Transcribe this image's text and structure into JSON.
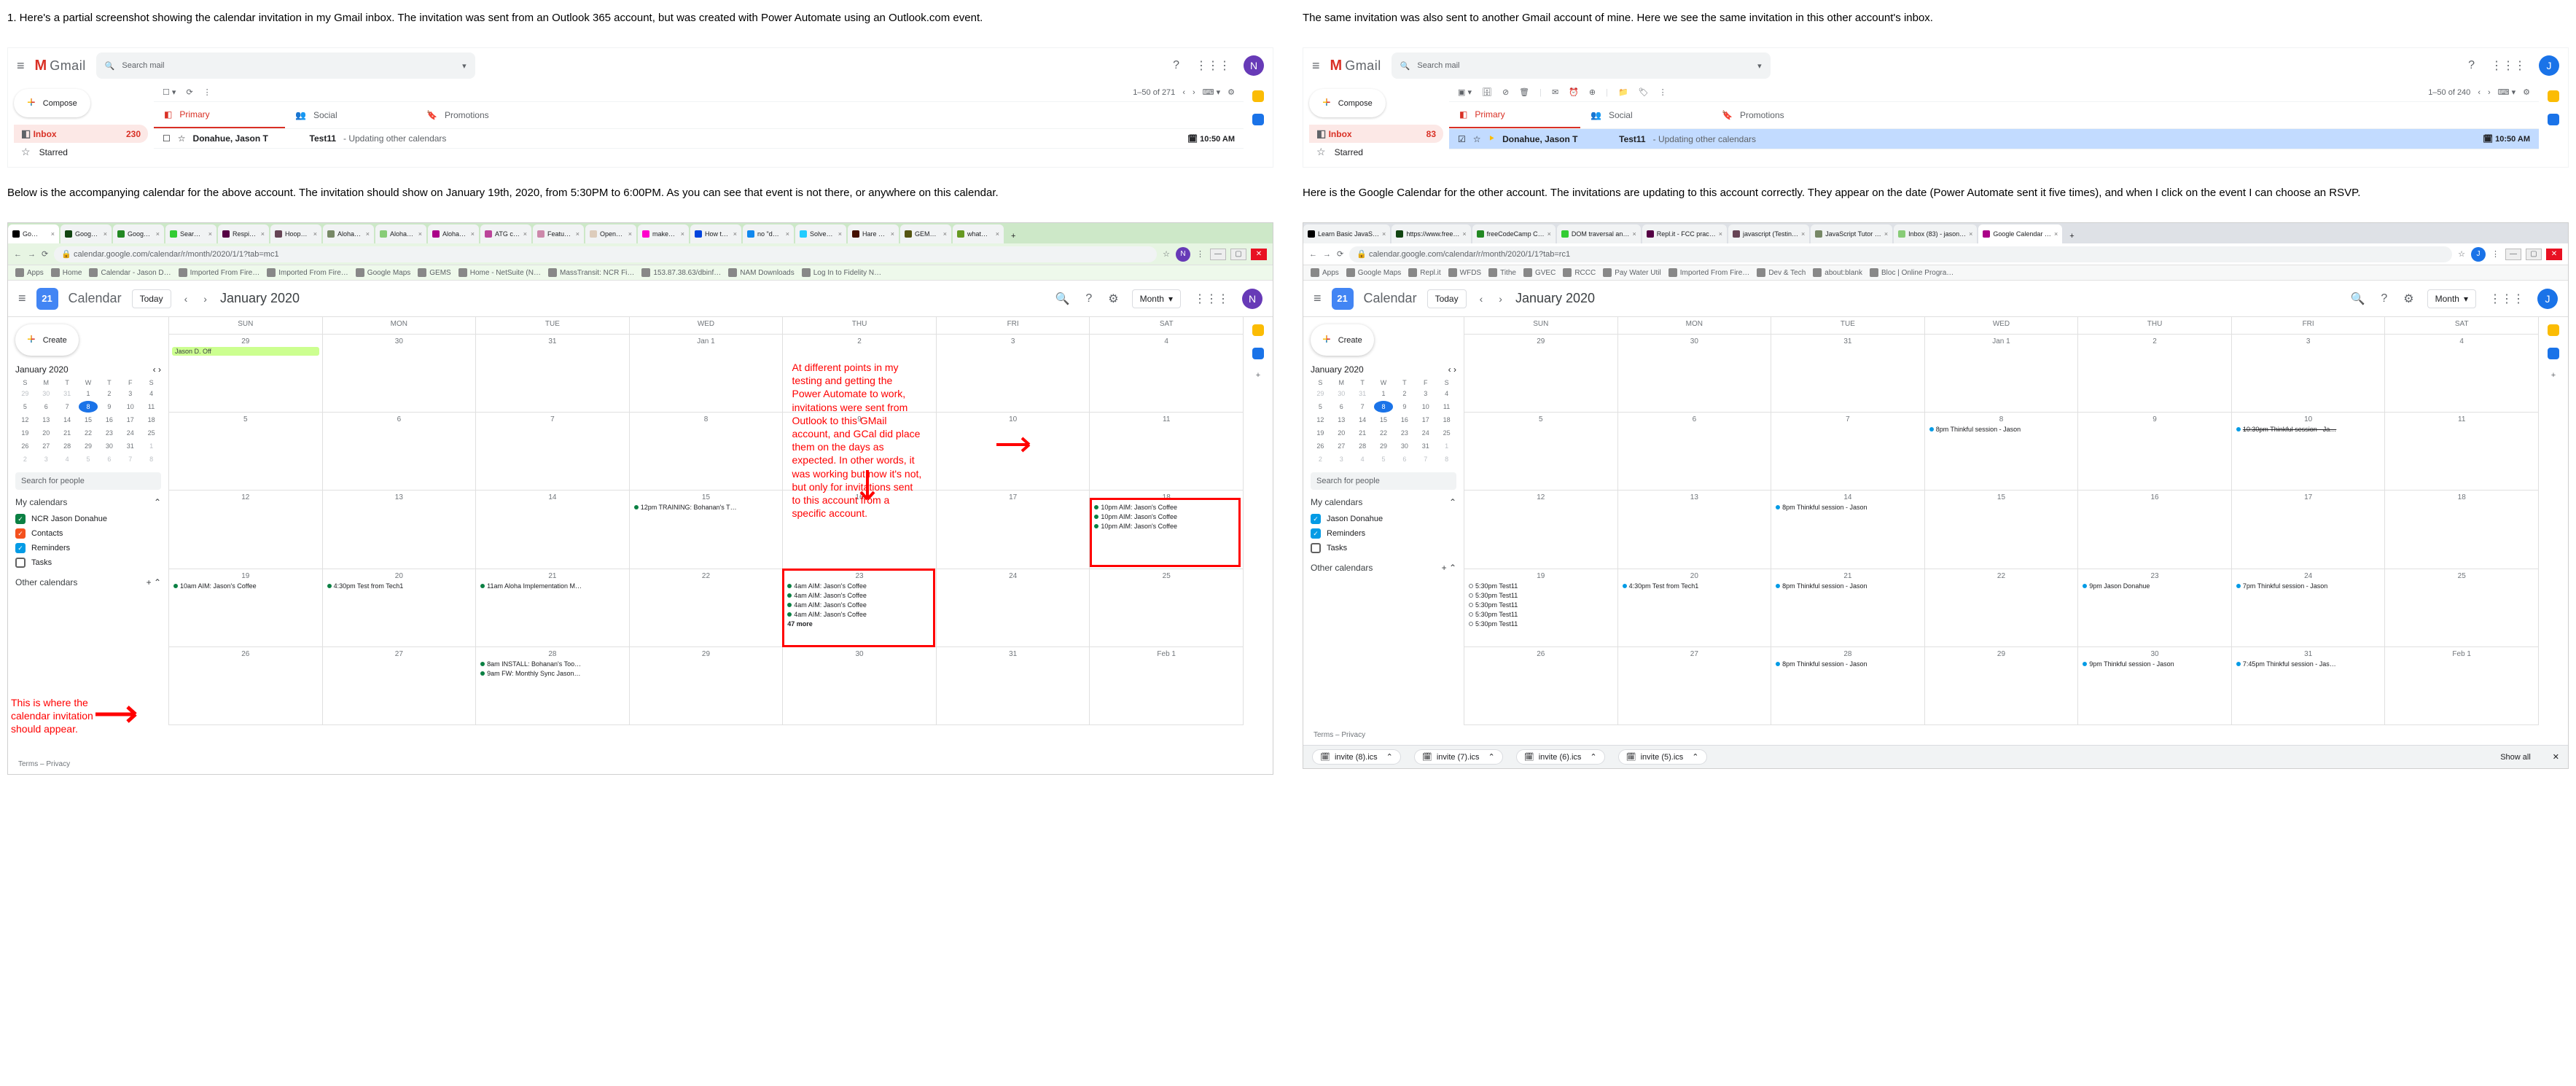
{
  "descriptions": {
    "left_intro": "1. Here's a partial screenshot showing the calendar invitation in my Gmail inbox. The invitation was sent from an Outlook 365 account, but was created with Power Automate using an Outlook.com event.",
    "right_intro": "The same invitation was also sent to another Gmail account of mine.  Here we see the same invitation in this other account's inbox.",
    "left_mid": "Below is the accompanying calendar for the above account.  The invitation should show on January 19th, 2020, from 5:30PM to 6:00PM. As you can see that event is not there, or anywhere on this calendar.",
    "right_mid": "Here is the Google Calendar for the other account.  The invitations are updating to this account correctly.  They appear on the date (Power Automate sent it five times), and when I click on the event I can choose an RSVP."
  },
  "gmail_common": {
    "logo_letter": "M",
    "logo_word": "Gmail",
    "search_placeholder": "Search mail",
    "compose": "Compose",
    "inbox": "Inbox",
    "starred": "Starred",
    "tabs": {
      "primary": "Primary",
      "social": "Social",
      "promotions": "Promotions"
    }
  },
  "gmail_left": {
    "inbox_count": "230",
    "page_range": "1–50 of 271",
    "avatar_letter": "N",
    "mail": {
      "sender": "Donahue, Jason T",
      "subject": "Test11",
      "snippet": " - Updating other calendars",
      "time": "10:50 AM"
    }
  },
  "gmail_right": {
    "inbox_count": "83",
    "page_range": "1–50 of 240",
    "avatar_letter": "J",
    "mail": {
      "sender": "Donahue, Jason T",
      "subject": "Test11",
      "snippet": " - Updating other calendars",
      "time": "10:50 AM"
    }
  },
  "browser_left": {
    "url": "calendar.google.com/calendar/r/month/2020/1/1?tab=mc1",
    "tabs": [
      "Go…",
      "Goog…",
      "Goog…",
      "Sear…",
      "Respi…",
      "Hoop…",
      "Aloha…",
      "Aloha…",
      "Aloha…",
      "ATG c…",
      "Featu…",
      "Open…",
      "make…",
      "How t…",
      "no \"d…",
      "Solve…",
      "Hare …",
      "GEM…",
      "what…"
    ],
    "bookmarks": [
      "Apps",
      "Home",
      "Calendar - Jason D…",
      "Imported From Fire…",
      "Imported From Fire…",
      "Google Maps",
      "GEMS",
      "Home - NetSuite (N…",
      "MassTransit: NCR Fi…",
      "153.87.38.63/dbinf…",
      "NAM Downloads",
      "Log In to Fidelity N…"
    ]
  },
  "browser_right": {
    "url": "calendar.google.com/calendar/r/month/2020/1/1?tab=rc1",
    "tabs": [
      "Learn Basic JavaS…",
      "https://www.free…",
      "freeCodeCamp C…",
      "DOM traversal an…",
      "Repl.it - FCC prac…",
      "javascript (Testin…",
      "JavaScript Tutor …",
      "Inbox (83) - jason…",
      "Google Calendar …"
    ],
    "bookmarks": [
      "Apps",
      "Google Maps",
      "Repl.it",
      "WFDS",
      "Tithe",
      "GVEC",
      "RCCC",
      "Pay Water Util",
      "Imported From Fire…",
      "Dev & Tech",
      "about:blank",
      "Bloc | Online Progra…"
    ]
  },
  "cal_common": {
    "app_name": "Calendar",
    "today": "Today",
    "month_label": "January 2020",
    "view": "Month",
    "create": "Create",
    "search_people": "Search for people",
    "my_calendars": "My calendars",
    "other_calendars": "Other calendars",
    "footer": "Terms – Privacy",
    "dow": [
      "SUN",
      "MON",
      "TUE",
      "WED",
      "THU",
      "FRI",
      "SAT"
    ],
    "mini_dow": [
      "S",
      "M",
      "T",
      "W",
      "T",
      "F",
      "S"
    ],
    "mini_month": "January 2020",
    "mini_days": [
      {
        "n": "29",
        "dim": true
      },
      {
        "n": "30",
        "dim": true
      },
      {
        "n": "31",
        "dim": true
      },
      {
        "n": "1"
      },
      {
        "n": "2"
      },
      {
        "n": "3"
      },
      {
        "n": "4"
      },
      {
        "n": "5"
      },
      {
        "n": "6"
      },
      {
        "n": "7"
      },
      {
        "n": "8",
        "today": true
      },
      {
        "n": "9"
      },
      {
        "n": "10"
      },
      {
        "n": "11"
      },
      {
        "n": "12"
      },
      {
        "n": "13"
      },
      {
        "n": "14"
      },
      {
        "n": "15"
      },
      {
        "n": "16"
      },
      {
        "n": "17"
      },
      {
        "n": "18"
      },
      {
        "n": "19"
      },
      {
        "n": "20"
      },
      {
        "n": "21"
      },
      {
        "n": "22"
      },
      {
        "n": "23"
      },
      {
        "n": "24"
      },
      {
        "n": "25"
      },
      {
        "n": "26"
      },
      {
        "n": "27"
      },
      {
        "n": "28"
      },
      {
        "n": "29"
      },
      {
        "n": "30"
      },
      {
        "n": "31"
      },
      {
        "n": "1",
        "dim": true
      },
      {
        "n": "2",
        "dim": true
      },
      {
        "n": "3",
        "dim": true
      },
      {
        "n": "4",
        "dim": true
      },
      {
        "n": "5",
        "dim": true
      },
      {
        "n": "6",
        "dim": true
      },
      {
        "n": "7",
        "dim": true
      },
      {
        "n": "8",
        "dim": true
      }
    ]
  },
  "cal_left": {
    "logo_day": "21",
    "avatar_letter": "N",
    "my_cals": [
      {
        "label": "NCR Jason Donahue",
        "color": "#0b8043",
        "on": true
      },
      {
        "label": "Contacts",
        "color": "#f4511e",
        "on": true
      },
      {
        "label": "Reminders",
        "color": "#039be5",
        "on": true
      },
      {
        "label": "Tasks",
        "color": "#616161",
        "on": false
      }
    ],
    "weeks": [
      [
        {
          "n": "29",
          "ev": [
            {
              "t": "Jason D. Off",
              "bar": "#ccff90"
            }
          ]
        },
        {
          "n": "30"
        },
        {
          "n": "31"
        },
        {
          "n": "Jan 1"
        },
        {
          "n": "2"
        },
        {
          "n": "3"
        },
        {
          "n": "4"
        }
      ],
      [
        {
          "n": "5"
        },
        {
          "n": "6"
        },
        {
          "n": "7"
        },
        {
          "n": "8"
        },
        {
          "n": "9"
        },
        {
          "n": "10"
        },
        {
          "n": "11"
        }
      ],
      [
        {
          "n": "12"
        },
        {
          "n": "13"
        },
        {
          "n": "14"
        },
        {
          "n": "15",
          "ev": [
            {
              "t": "12pm TRAINING: Bohanan's T…",
              "c": "#0b8043"
            }
          ]
        },
        {
          "n": "16"
        },
        {
          "n": "17"
        },
        {
          "n": "18",
          "ev": [
            {
              "t": "10pm AIM: Jason's Coffee",
              "c": "#0b8043"
            },
            {
              "t": "10pm AIM: Jason's Coffee",
              "c": "#0b8043"
            },
            {
              "t": "10pm AIM: Jason's Coffee",
              "c": "#0b8043"
            }
          ]
        }
      ],
      [
        {
          "n": "19",
          "ev": [
            {
              "t": "10am AIM: Jason's Coffee",
              "c": "#0b8043"
            }
          ]
        },
        {
          "n": "20",
          "ev": [
            {
              "t": "4:30pm Test from Tech1",
              "c": "#0b8043"
            }
          ]
        },
        {
          "n": "21",
          "ev": [
            {
              "t": "11am Aloha Implementation M…",
              "c": "#0b8043"
            }
          ]
        },
        {
          "n": "22"
        },
        {
          "n": "23",
          "ev": [
            {
              "t": "4am AIM: Jason's Coffee",
              "c": "#0b8043"
            },
            {
              "t": "4am AIM: Jason's Coffee",
              "c": "#0b8043"
            },
            {
              "t": "4am AIM: Jason's Coffee",
              "c": "#0b8043"
            },
            {
              "t": "4am AIM: Jason's Coffee",
              "c": "#0b8043"
            }
          ],
          "more": "47 more"
        },
        {
          "n": "24"
        },
        {
          "n": "25"
        }
      ],
      [
        {
          "n": "26"
        },
        {
          "n": "27"
        },
        {
          "n": "28",
          "ev": [
            {
              "t": "8am INSTALL: Bohanan's Too…",
              "c": "#0b8043"
            },
            {
              "t": "9am FW: Monthly Sync Jason…",
              "c": "#0b8043"
            }
          ]
        },
        {
          "n": "29"
        },
        {
          "n": "30"
        },
        {
          "n": "31"
        },
        {
          "n": "Feb 1"
        }
      ]
    ]
  },
  "cal_right": {
    "logo_day": "21",
    "avatar_letter": "J",
    "my_cals": [
      {
        "label": "Jason Donahue",
        "color": "#039be5",
        "on": true
      },
      {
        "label": "Reminders",
        "color": "#039be5",
        "on": true
      },
      {
        "label": "Tasks",
        "color": "#616161",
        "on": false
      }
    ],
    "weeks": [
      [
        {
          "n": "29"
        },
        {
          "n": "30"
        },
        {
          "n": "31"
        },
        {
          "n": "Jan 1"
        },
        {
          "n": "2"
        },
        {
          "n": "3"
        },
        {
          "n": "4"
        }
      ],
      [
        {
          "n": "5"
        },
        {
          "n": "6"
        },
        {
          "n": "7"
        },
        {
          "n": "8",
          "ev": [
            {
              "t": "8pm Thinkful session - Jason",
              "c": "#039be5"
            }
          ]
        },
        {
          "n": "9"
        },
        {
          "n": "10",
          "ev": [
            {
              "t": "10:30pm Thinkful session - Ja…",
              "c": "#039be5",
              "strike": true
            }
          ]
        },
        {
          "n": "11"
        }
      ],
      [
        {
          "n": "12"
        },
        {
          "n": "13"
        },
        {
          "n": "14",
          "ev": [
            {
              "t": "8pm Thinkful session - Jason",
              "c": "#039be5"
            }
          ]
        },
        {
          "n": "15"
        },
        {
          "n": "16"
        },
        {
          "n": "17"
        },
        {
          "n": "18"
        }
      ],
      [
        {
          "n": "19",
          "ev": [
            {
              "t": "5:30pm Test11",
              "hollow": true
            },
            {
              "t": "5:30pm Test11",
              "hollow": true
            },
            {
              "t": "5:30pm Test11",
              "hollow": true
            },
            {
              "t": "5:30pm Test11",
              "hollow": true
            },
            {
              "t": "5:30pm Test11",
              "hollow": true
            }
          ]
        },
        {
          "n": "20",
          "ev": [
            {
              "t": "4:30pm Test from Tech1",
              "c": "#039be5"
            }
          ]
        },
        {
          "n": "21",
          "ev": [
            {
              "t": "8pm Thinkful session - Jason",
              "c": "#039be5"
            }
          ]
        },
        {
          "n": "22"
        },
        {
          "n": "23",
          "ev": [
            {
              "t": "9pm Jason Donahue",
              "c": "#039be5"
            }
          ]
        },
        {
          "n": "24",
          "ev": [
            {
              "t": "7pm Thinkful session - Jason",
              "c": "#039be5"
            }
          ]
        },
        {
          "n": "25"
        }
      ],
      [
        {
          "n": "26"
        },
        {
          "n": "27"
        },
        {
          "n": "28",
          "ev": [
            {
              "t": "8pm Thinkful session - Jason",
              "c": "#039be5"
            }
          ]
        },
        {
          "n": "29"
        },
        {
          "n": "30",
          "ev": [
            {
              "t": "9pm Thinkful session - Jason",
              "c": "#039be5"
            }
          ]
        },
        {
          "n": "31",
          "ev": [
            {
              "t": "7:45pm Thinkful session - Jas…",
              "c": "#039be5"
            }
          ]
        },
        {
          "n": "Feb 1"
        }
      ]
    ],
    "downloads": [
      "invite (8).ics",
      "invite (7).ics",
      "invite (6).ics",
      "invite (5).ics"
    ],
    "show_all": "Show all"
  },
  "annotations": {
    "left_side": "This is where the calendar invitation should appear.",
    "left_main": "At different points in my testing and getting the Power Automate to work, invitations were sent from Outlook to this GMail account, and GCal did place them on the days as expected.  In other words, it was working but now it's not, but only for invitations sent to this account from a specific account."
  }
}
